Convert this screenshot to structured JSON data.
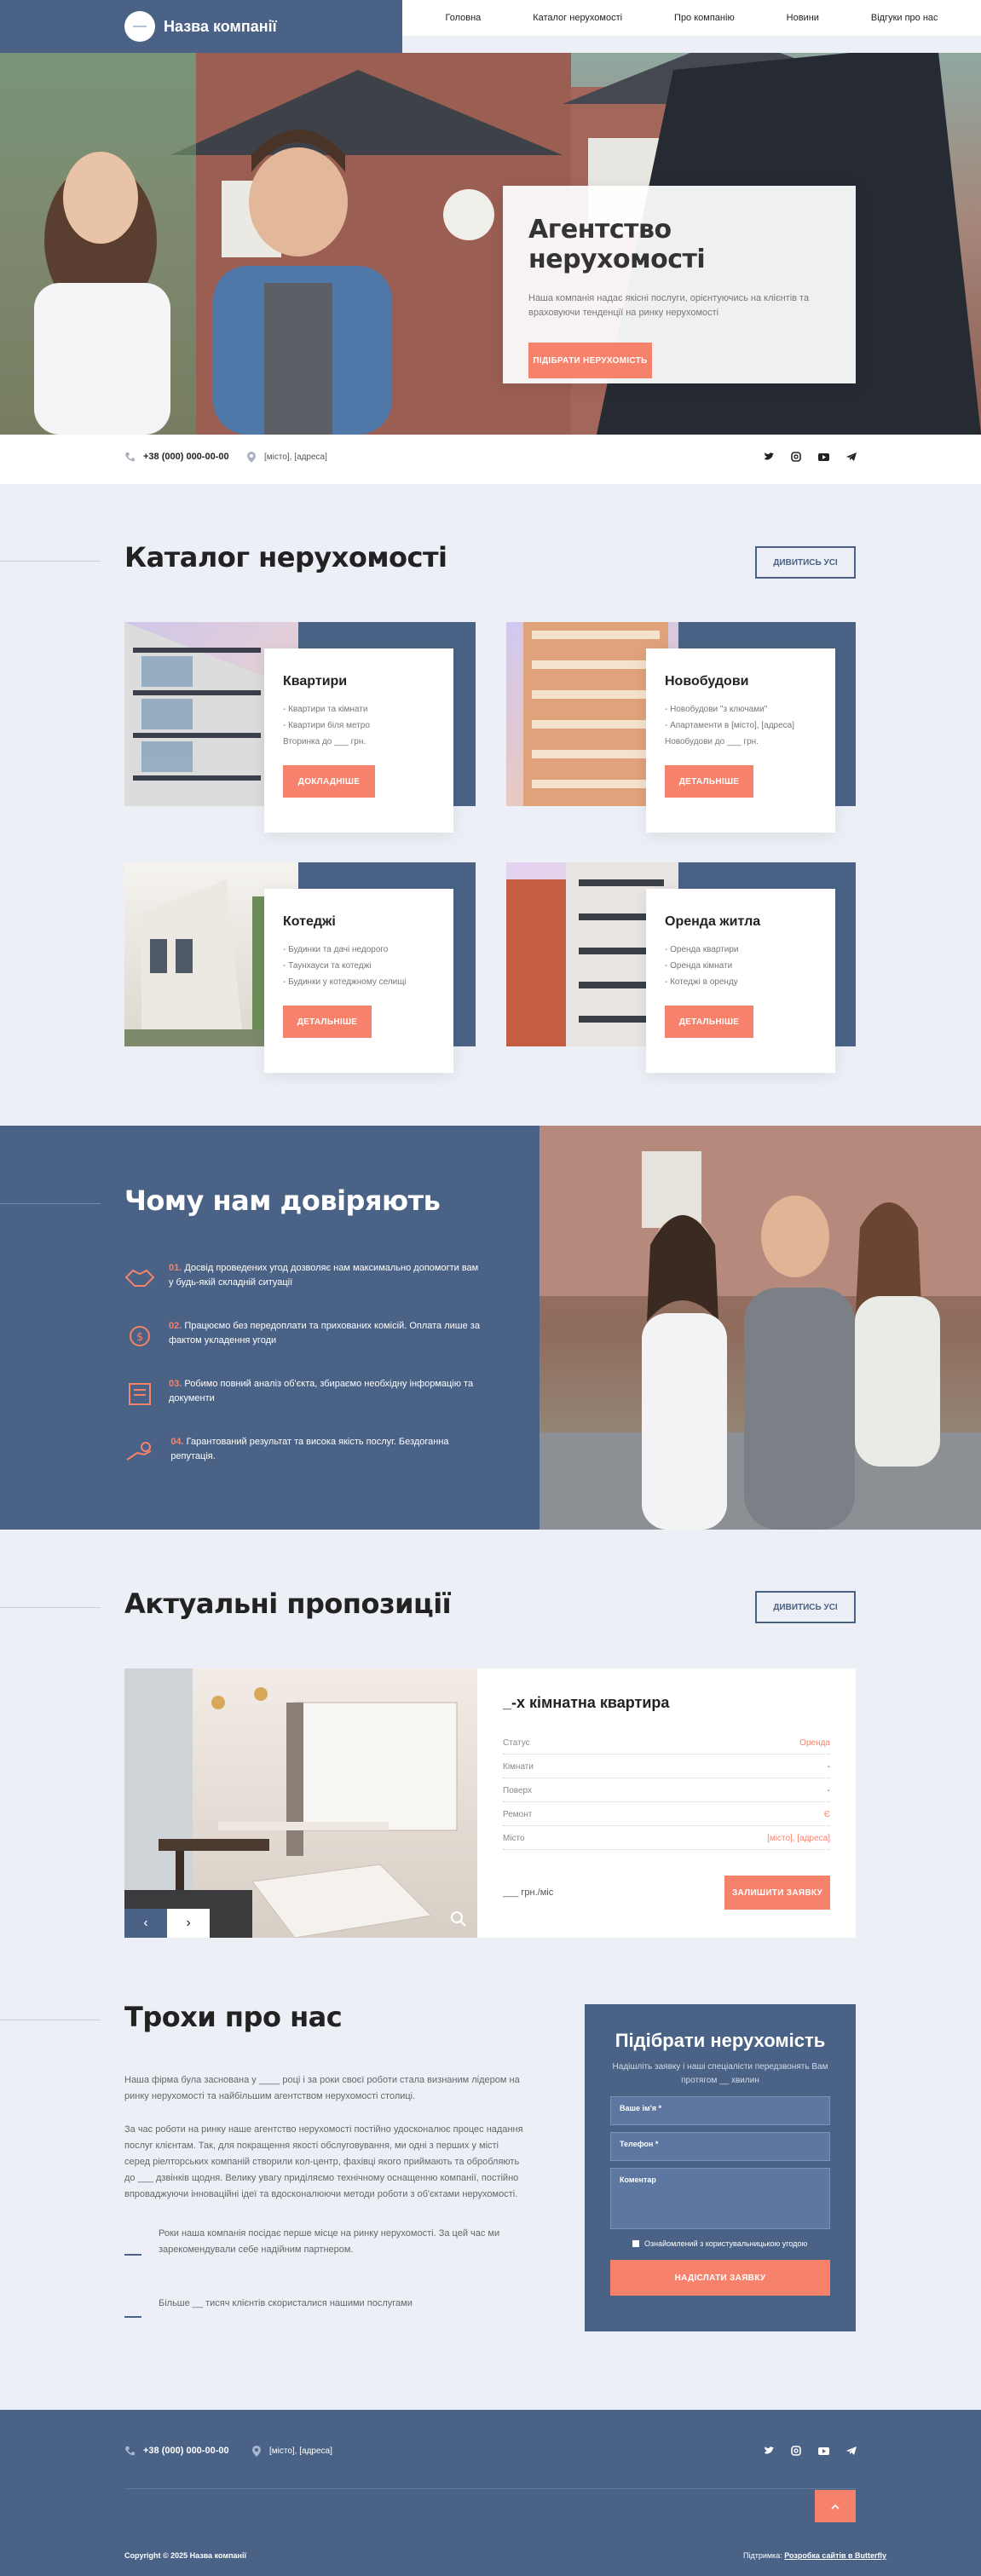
{
  "header": {
    "company_name": "Назва компанії",
    "logo_icon": "circle-logo-icon",
    "nav": [
      "Головна",
      "Каталог нерухомості",
      "Про компанію",
      "Новини",
      "Відгуки про нас"
    ]
  },
  "hero": {
    "title": "Агентство нерухомості",
    "text": "Наша компанія надає якісні послуги, орієнтуючись на клієнтів та враховуючи тенденції на ринку нерухомості",
    "button": "Підібрати нерухомість"
  },
  "contact_bar": {
    "phone": "+38 (000) 000-00-00",
    "address": "[місто], [адреса]",
    "socials": [
      "twitter-icon",
      "instagram-icon",
      "youtube-icon",
      "telegram-icon"
    ]
  },
  "catalog": {
    "title": "Каталог нерухомості",
    "view_all": "Дивитись усі",
    "cards": [
      {
        "title": "Квартири",
        "items": [
          "- Квартири та кімнати",
          "- Квартири біля метро",
          "Вторинка до ___ грн."
        ],
        "button": "Докладніше"
      },
      {
        "title": "Новобудови",
        "items": [
          "- Новобудови \"з ключами\"",
          "- Апартаменти в [місто], [адреса]",
          "Новобудови до ___ грн."
        ],
        "button": "Детальніше"
      },
      {
        "title": "Котеджі",
        "items": [
          "- Будинки та дачі недорого",
          "- Таунхауси та котеджі",
          "- Будинки у котеджному селищі"
        ],
        "button": "Детальніше"
      },
      {
        "title": "Оренда житла",
        "items": [
          "- Оренда квартири",
          "- Оренда кімнати",
          "- Котеджі в оренду"
        ],
        "button": "Детальніше"
      }
    ]
  },
  "trust": {
    "title": "Чому нам довіряють",
    "items": [
      {
        "num": "01.",
        "text": "Досвід проведених угод дозволяє нам максимально допомогти вам у будь-якій складній ситуації",
        "icon": "handshake-icon"
      },
      {
        "num": "02.",
        "text": "Працюємо без передоплати та прихованих комісій. Оплата лише за фактом укладення угоди",
        "icon": "money-icon"
      },
      {
        "num": "03.",
        "text": "Робимо повний аналіз об'єкта, збираємо необхідну інформацію та документи",
        "icon": "document-icon"
      },
      {
        "num": "04.",
        "text": "Гарантований результат та висока якість послуг. Бездоганна репутація.",
        "icon": "key-hand-icon"
      }
    ]
  },
  "offers": {
    "title": "Актуальні пропозиції",
    "view_all": "Дивитись усі",
    "listing": {
      "title": "_-х кімнатна квартира",
      "rows": [
        {
          "label": "Статус",
          "value": "Оренда",
          "accent": true
        },
        {
          "label": "Кімнати",
          "value": "-",
          "accent": false
        },
        {
          "label": "Поверх",
          "value": "-",
          "accent": false
        },
        {
          "label": "Ремонт",
          "value": "Є",
          "accent": true
        },
        {
          "label": "Місто",
          "value": "[місто], [адреса]",
          "accent": true
        }
      ],
      "price": "___ грн./міс",
      "button": "Залишити заявку"
    },
    "prev": "‹",
    "next": "›"
  },
  "about": {
    "title": "Трохи про нас",
    "p1": "Наша фірма була заснована у ____ році і за роки своєї роботи стала визнаним лідером на ринку нерухомості та найбільшим агентством нерухомості столиці.",
    "p2": "За час роботи на ринку наше агентство нерухомості постійно удосконалює процес надання послуг клієнтам. Так, для покращення якості обслуговування, ми одні з перших у місті серед ріелторських компаній створили кол-центр, фахівці якого приймають та обробляють до ___ дзвінків щодня. Велику увагу приділяємо технічному оснащенню компанії, постійно впроваджуючи інноваційні ідеї та вдосконалюючи методи роботи з об'єктами нерухомості.",
    "fact1": "Роки наша компанія посідає перше місце на ринку нерухомості. За цей час ми зарекомендували себе надійним партнером.",
    "fact2": "Більше __ тисяч клієнтів скористалися нашими послугами"
  },
  "form": {
    "title": "Підібрати нерухомість",
    "subtitle": "Надішліть заявку і наші спеціалісти передзвонять Вам протягом __ хвилин",
    "name": "Ваше ім'я *",
    "phone": "Телефон *",
    "comment": "Коментар",
    "consent": "Ознайомлений з користувальницькою угодою",
    "button": "Надіслати заявку"
  },
  "footer": {
    "phone": "+38 (000) 000-00-00",
    "address": "[місто], [адреса]",
    "copyright": "Copyright © 2025 Назва компанії",
    "dev_prefix": "Підтримка:",
    "dev_link": "Розробка сайтів в Butterfly"
  }
}
